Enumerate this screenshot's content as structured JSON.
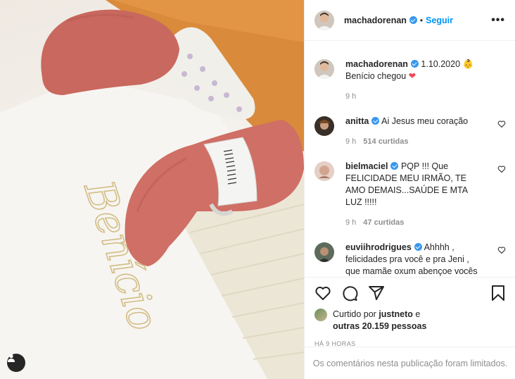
{
  "colors": {
    "accent": "#0095f6",
    "verified": "#3897f0",
    "heart": "#ed4956",
    "muted": "#8e8e8e"
  },
  "photo": {
    "embroidery_text": "Benício",
    "tag_icon": "user-tag-icon"
  },
  "header": {
    "username": "machadorenan",
    "separator": "•",
    "follow_label": "Seguir",
    "more_label": "•••"
  },
  "caption": {
    "username": "machadorenan",
    "date": "1.10.2020",
    "emoji": "👶",
    "text": "Benício chegou",
    "heart": "❤",
    "time": "9 h"
  },
  "comments": [
    {
      "username": "anitta",
      "text": "Ai Jesus meu coração",
      "time": "9 h",
      "likes": "514 curtidas"
    },
    {
      "username": "bielmaciel",
      "text": "PQP !!! Que FELICIDADE MEU IRMÃO, TE AMO DEMAIS...SAÚDE E MTA LUZ !!!!!",
      "time": "9 h",
      "likes": "47 curtidas"
    },
    {
      "username": "euviihrodrigues",
      "text": "Ahhhh , felicidades pra você e pra Jeni , que mamãe oxum abençoe vocês 🙏🤩",
      "time": "",
      "likes": ""
    }
  ],
  "likes": {
    "prefix": "Curtido por",
    "user": "justneto",
    "connector": "e",
    "others": "outras 20.159 pessoas"
  },
  "timestamp": "HÁ 9 HORAS",
  "limited_notice": "Os comentários nesta publicação foram limitados."
}
